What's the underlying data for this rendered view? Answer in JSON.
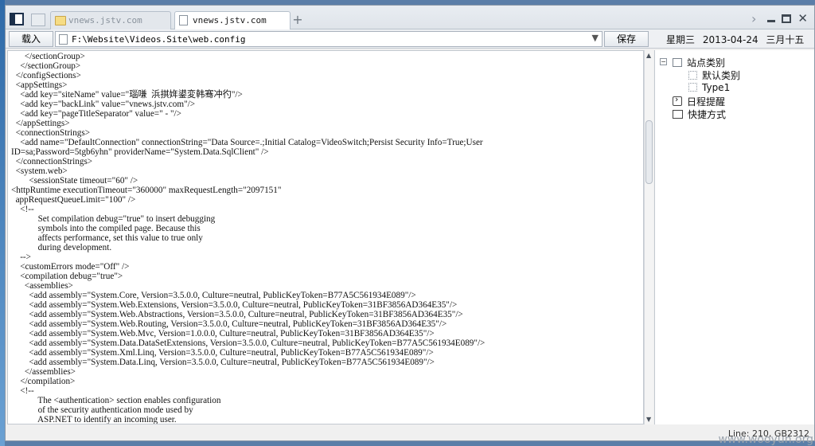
{
  "tabs": [
    {
      "label": "vnews.jstv.com",
      "active": false
    },
    {
      "label": "vnews.jstv.com",
      "active": true
    }
  ],
  "toolbar": {
    "load_label": "载入",
    "save_label": "保存",
    "path_value": "F:\\Website\\Videos.Site\\web.config"
  },
  "date": {
    "weekday": "星期三",
    "date": "2013-04-24",
    "lunar": "三月十五"
  },
  "tree": {
    "root": "站点类别",
    "children": [
      "默认类别",
      "Type1"
    ],
    "schedule": "日程提醒",
    "shortcuts": "快捷方式"
  },
  "editor_lines": [
    "      </sectionGroup>",
    "    </sectionGroup>",
    "  </configSections>",
    "  <appSettings>",
    "    <add key=\"siteName\" value=\"瑙嗛  浜掑姩鍙変韩骞冲彴\"/>",
    "    <add key=\"backLink\" value=\"vnews.jstv.com\"/>",
    "    <add key=\"pageTitleSeparator\" value=\" - \"/>",
    "  </appSettings>",
    "  <connectionStrings>",
    "    <add name=\"DefaultConnection\" connectionString=\"Data Source=.;Initial Catalog=VideoSwitch;Persist Security Info=True;User",
    "ID=sa;Password=5tgb6yhn\" providerName=\"System.Data.SqlClient\" />",
    "  </connectionStrings>",
    "  <system.web>",
    "        <sessionState timeout=\"60\" />",
    "<httpRuntime executionTimeout=\"360000\" maxRequestLength=\"2097151\"",
    "  appRequestQueueLimit=\"100\" />",
    "    <!--",
    "            Set compilation debug=\"true\" to insert debugging",
    "            symbols into the compiled page. Because this",
    "            affects performance, set this value to true only",
    "            during development.",
    "    -->",
    "    <customErrors mode=\"Off\" />",
    "    <compilation debug=\"true\">",
    "      <assemblies>",
    "        <add assembly=\"System.Core, Version=3.5.0.0, Culture=neutral, PublicKeyToken=B77A5C561934E089\"/>",
    "        <add assembly=\"System.Web.Extensions, Version=3.5.0.0, Culture=neutral, PublicKeyToken=31BF3856AD364E35\"/>",
    "        <add assembly=\"System.Web.Abstractions, Version=3.5.0.0, Culture=neutral, PublicKeyToken=31BF3856AD364E35\"/>",
    "        <add assembly=\"System.Web.Routing, Version=3.5.0.0, Culture=neutral, PublicKeyToken=31BF3856AD364E35\"/>",
    "        <add assembly=\"System.Web.Mvc, Version=1.0.0.0, Culture=neutral, PublicKeyToken=31BF3856AD364E35\"/>",
    "        <add assembly=\"System.Data.DataSetExtensions, Version=3.5.0.0, Culture=neutral, PublicKeyToken=B77A5C561934E089\"/>",
    "        <add assembly=\"System.Xml.Linq, Version=3.5.0.0, Culture=neutral, PublicKeyToken=B77A5C561934E089\"/>",
    "        <add assembly=\"System.Data.Linq, Version=3.5.0.0, Culture=neutral, PublicKeyToken=B77A5C561934E089\"/>",
    "      </assemblies>",
    "    </compilation>",
    "    <!--",
    "            The <authentication> section enables configuration",
    "            of the security authentication mode used by",
    "            ASP.NET to identify an incoming user."
  ],
  "status": {
    "text": "Line: 210, GB2312"
  },
  "watermark": "www.wooyun.org"
}
